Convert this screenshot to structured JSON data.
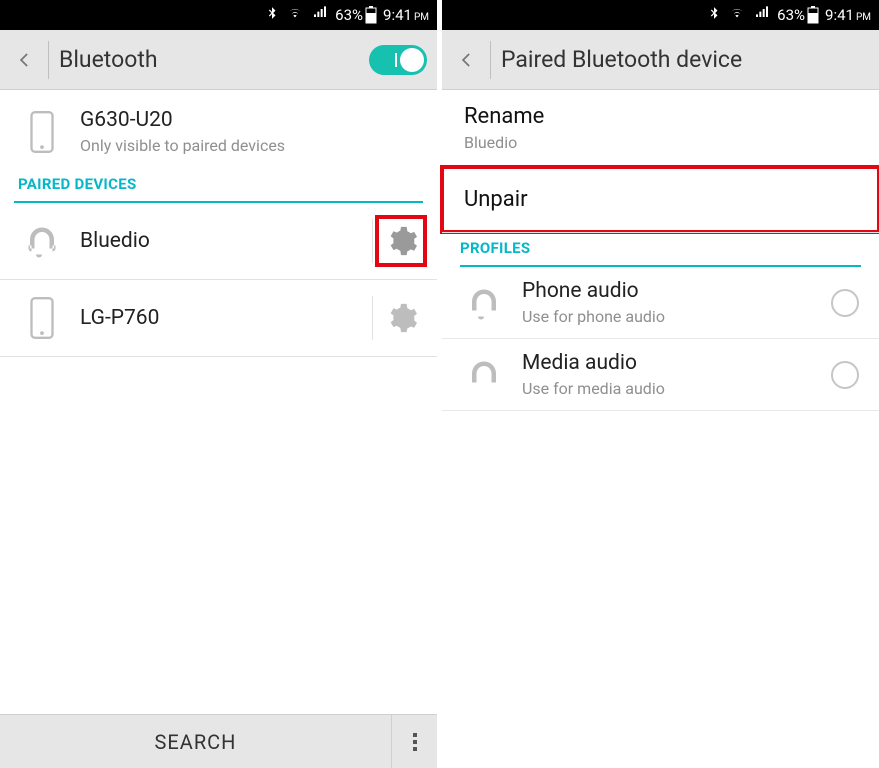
{
  "status": {
    "battery_pct": "63%",
    "time": "9:41",
    "ampm": "PM"
  },
  "left": {
    "header_title": "Bluetooth",
    "own": {
      "name": "G630-U20",
      "visibility": "Only visible to paired devices"
    },
    "section_paired": "PAIRED DEVICES",
    "devices": [
      {
        "name": "Bluedio",
        "icon": "headphones",
        "highlighted": true
      },
      {
        "name": "LG-P760",
        "icon": "phone",
        "highlighted": false
      }
    ],
    "search_label": "SEARCH"
  },
  "right": {
    "header_title": "Paired Bluetooth device",
    "rename_label": "Rename",
    "rename_value": "Bluedio",
    "unpair_label": "Unpair",
    "section_profiles": "PROFILES",
    "profiles": [
      {
        "title": "Phone audio",
        "sub": "Use for phone audio",
        "icon": "headset",
        "checked": false
      },
      {
        "title": "Media audio",
        "sub": "Use for media audio",
        "icon": "headphones",
        "checked": false
      }
    ]
  }
}
